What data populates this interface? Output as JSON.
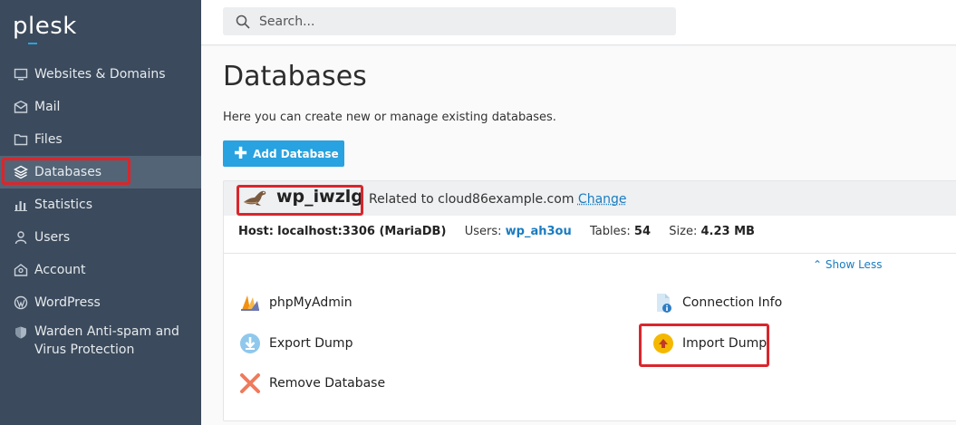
{
  "app": {
    "logo": "plesk"
  },
  "sidebar": {
    "items": [
      {
        "label": "Websites & Domains",
        "icon": "monitor-icon"
      },
      {
        "label": "Mail",
        "icon": "envelope-icon"
      },
      {
        "label": "Files",
        "icon": "folder-icon"
      },
      {
        "label": "Databases",
        "icon": "layers-icon",
        "active": true
      },
      {
        "label": "Statistics",
        "icon": "bar-chart-icon"
      },
      {
        "label": "Users",
        "icon": "user-icon"
      },
      {
        "label": "Account",
        "icon": "account-icon"
      },
      {
        "label": "WordPress",
        "icon": "wordpress-icon"
      },
      {
        "label": "Warden Anti-spam and",
        "label2": "Virus Protection",
        "icon": "shield-icon"
      }
    ]
  },
  "search": {
    "placeholder": "Search..."
  },
  "main": {
    "title": "Databases",
    "description": "Here you can create new or manage existing databases.",
    "add_button": "Add Database"
  },
  "database": {
    "name": "wp_iwzlg",
    "related_prefix": "Related to cloud86example.com",
    "change_link": "Change",
    "host_label": "Host:",
    "host_value": "localhost:3306 (MariaDB)",
    "users_label": "Users:",
    "users_value": "wp_ah3ou",
    "tables_label": "Tables:",
    "tables_value": "54",
    "size_label": "Size:",
    "size_value": "4.23 MB",
    "show_less": "Show Less",
    "actions": {
      "phpmyadmin": "phpMyAdmin",
      "connection_info": "Connection Info",
      "export_dump": "Export Dump",
      "import_dump": "Import Dump",
      "remove_database": "Remove Database"
    }
  },
  "colors": {
    "sidebar_bg": "#3b4a5c",
    "accent": "#28a2e0",
    "link": "#1a7cc1",
    "highlight": "#d9262c"
  }
}
